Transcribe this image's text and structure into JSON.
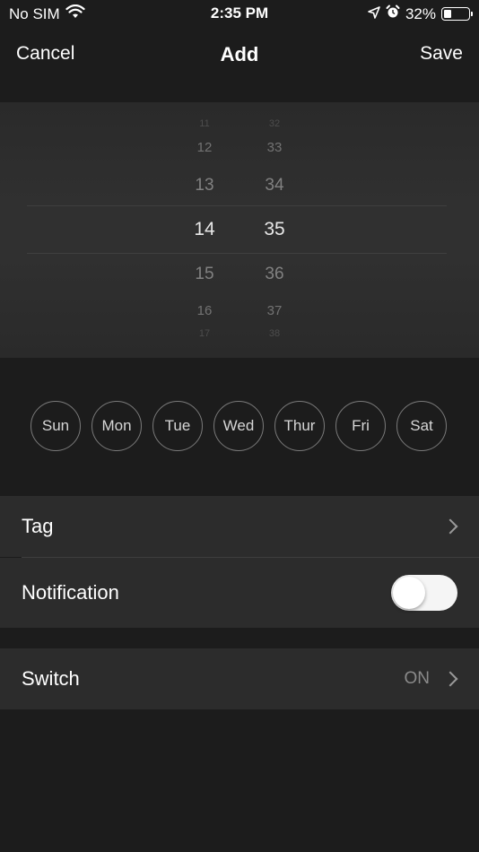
{
  "status_bar": {
    "carrier": "No SIM",
    "time": "2:35 PM",
    "battery": "32%",
    "battery_level": 0.32
  },
  "nav": {
    "cancel_label": "Cancel",
    "title": "Add",
    "save_label": "Save"
  },
  "picker": {
    "hours": [
      "11",
      "12",
      "13",
      "14",
      "15",
      "16",
      "17"
    ],
    "minutes": [
      "32",
      "33",
      "34",
      "35",
      "36",
      "37",
      "38"
    ],
    "selected_hour": "14",
    "selected_minute": "35"
  },
  "weekdays": [
    "Sun",
    "Mon",
    "Tue",
    "Wed",
    "Thur",
    "Fri",
    "Sat"
  ],
  "rows": {
    "tag_label": "Tag",
    "notification_label": "Notification",
    "notification_on": false,
    "switch_label": "Switch",
    "switch_value": "ON"
  },
  "icons": {
    "wifi": "wifi-icon",
    "location": "location-arrow-icon",
    "alarm": "alarm-clock-icon",
    "battery": "battery-icon",
    "chevron": "chevron-right-icon"
  },
  "colors": {
    "background": "#1c1c1c",
    "row_background": "#2c2c2c",
    "picker_background": "#303030",
    "text_primary": "#ffffff",
    "text_secondary": "#8a8a8a"
  }
}
